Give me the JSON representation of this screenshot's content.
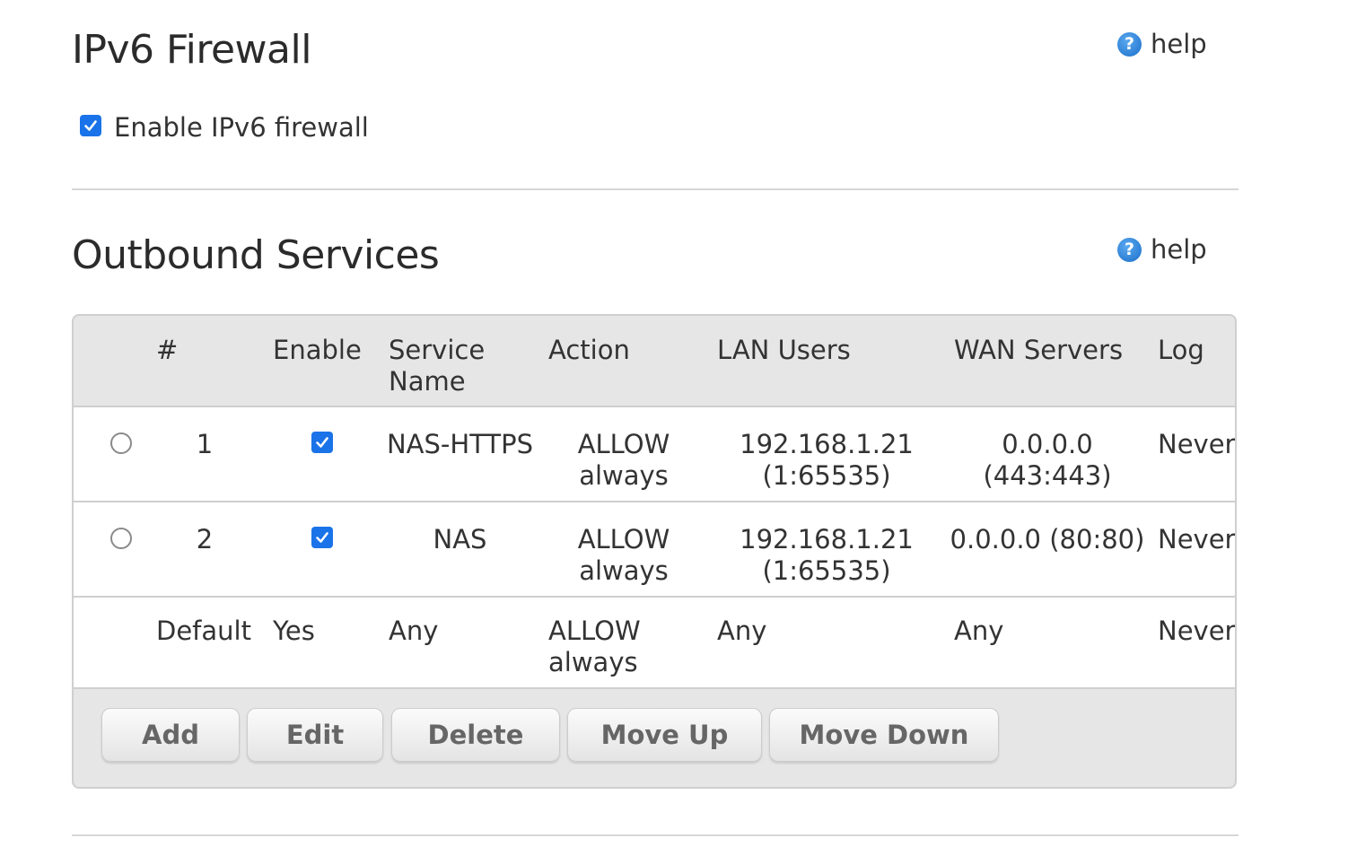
{
  "ipv6_firewall": {
    "title": "IPv6 Firewall",
    "help_label": "help",
    "enable_label": "Enable IPv6 firewall",
    "enabled": true
  },
  "outbound": {
    "title": "Outbound Services",
    "help_label": "help",
    "columns": {
      "num": "#",
      "enable": "Enable",
      "service_name_1": "Service",
      "service_name_2": "Name",
      "action": "Action",
      "lan_users": "LAN Users",
      "wan_servers": "WAN Servers",
      "log": "Log"
    },
    "rows": [
      {
        "num": "1",
        "enabled": true,
        "service": "NAS-HTTPS",
        "action_1": "ALLOW",
        "action_2": "always",
        "lan_1": "192.168.1.21",
        "lan_2": "(1:65535)",
        "wan_1": "0.0.0.0",
        "wan_2": "(443:443)",
        "log": "Never"
      },
      {
        "num": "2",
        "enabled": true,
        "service": "NAS",
        "action_1": "ALLOW",
        "action_2": "always",
        "lan_1": "192.168.1.21",
        "lan_2": "(1:65535)",
        "wan_1": "0.0.0.0 (80:80)",
        "wan_2": "",
        "log": "Never"
      }
    ],
    "default_row": {
      "num": "Default",
      "enable": "Yes",
      "service": "Any",
      "action_1": "ALLOW",
      "action_2": "always",
      "lan": "Any",
      "wan": "Any",
      "log": "Never"
    },
    "buttons": {
      "add": "Add",
      "edit": "Edit",
      "delete": "Delete",
      "move_up": "Move Up",
      "move_down": "Move Down"
    }
  },
  "colors": {
    "accent": "#1a73e8",
    "help_icon": "#1b6fc9",
    "panel_bg": "#e6e6e6",
    "divider": "#d6d6d6"
  },
  "icons": {
    "help": "help-circle-icon",
    "checkbox": "checkmark-icon"
  }
}
